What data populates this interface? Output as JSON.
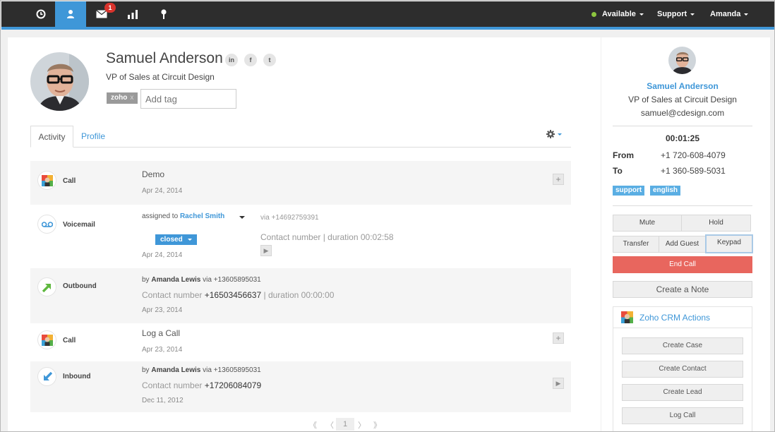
{
  "topbar": {
    "nav": [
      {
        "icon": "clock-icon"
      },
      {
        "icon": "user-icon"
      },
      {
        "icon": "mail-icon",
        "badge": "1"
      },
      {
        "icon": "bar-chart-icon"
      },
      {
        "icon": "pin-icon"
      }
    ],
    "status": "Available",
    "support": "Support",
    "user": "Amanda"
  },
  "contact": {
    "name": "Samuel Anderson",
    "title": "VP of Sales at Circuit Design",
    "social": [
      "in",
      "f",
      "t"
    ],
    "tag": "zoho",
    "tag_remove": "x",
    "tag_placeholder": "Add tag"
  },
  "tabs": {
    "activity": "Activity",
    "profile": "Profile"
  },
  "activities": [
    {
      "type": "Call",
      "title": "Demo",
      "date": "Apr 24, 2014"
    },
    {
      "type": "Voicemail",
      "assigned_prefix": "assigned to",
      "assignee": "Rachel Smith",
      "via": "via +14692759391",
      "status": "closed",
      "meta": "Contact number | duration 00:02:58",
      "date": "Apr 24, 2014"
    },
    {
      "type": "Outbound",
      "by_prefix": "by",
      "by": "Amanda Lewis",
      "via": "via +13605895031",
      "contact_prefix": "Contact number",
      "number": "+16503456637",
      "duration": "| duration 00:00:00",
      "date": "Apr 23, 2014"
    },
    {
      "type": "Call",
      "title": "Log a Call",
      "date": "Apr 23, 2014"
    },
    {
      "type": "Inbound",
      "by_prefix": "by",
      "by": "Amanda Lewis",
      "via": "via +13605895031",
      "contact_prefix": "Contact number",
      "number": "+17206084079",
      "date": "Dec 11, 2012"
    }
  ],
  "pager": {
    "first": "《",
    "prev": "〈",
    "current": "1",
    "next": "〉",
    "last": "》"
  },
  "side": {
    "name": "Samuel Anderson",
    "title": "VP of Sales at Circuit Design",
    "email": "samuel@cdesign.com",
    "timer": "00:01:25",
    "from_label": "From",
    "from": "+1 720-608-4079",
    "to_label": "To",
    "to": "+1 360-589-5031",
    "tags": [
      "support",
      "english"
    ],
    "buttons": {
      "mute": "Mute",
      "hold": "Hold",
      "transfer": "Transfer",
      "add_guest": "Add Guest",
      "keypad": "Keypad",
      "end_call": "End Call",
      "create_note": "Create a Note"
    },
    "crm": {
      "title": "Zoho CRM Actions",
      "actions": [
        "Create Case",
        "Create Contact",
        "Create Lead",
        "Log Call"
      ]
    }
  },
  "colors": {
    "accent": "#3f97d8",
    "topbar": "#2d2d2d",
    "end_call": "#e8665e",
    "badge": "#d9332c",
    "status": "#8dc63f"
  }
}
